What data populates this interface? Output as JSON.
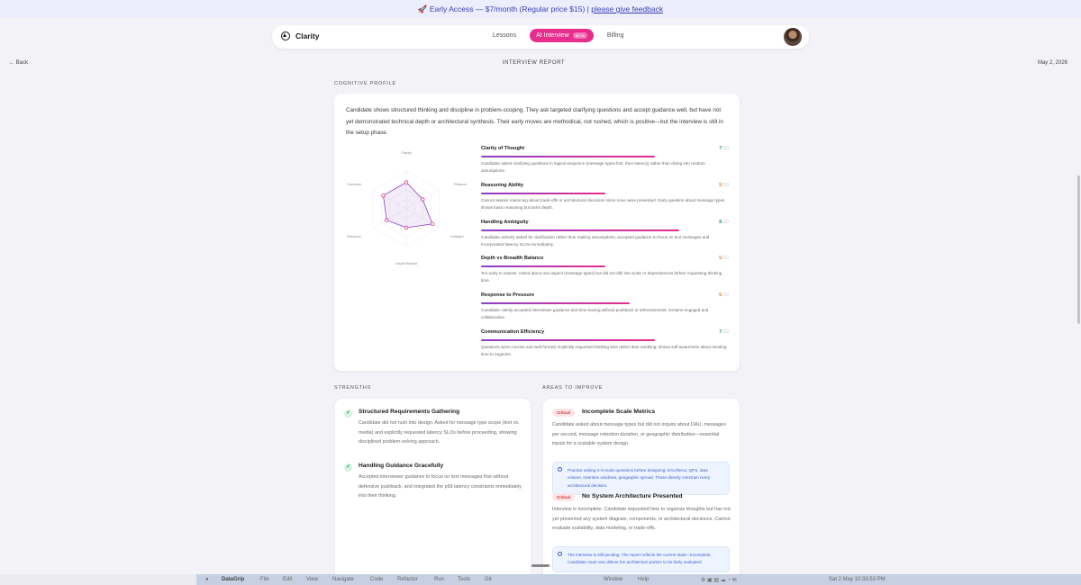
{
  "banner": {
    "text": "🚀 Early Access — $7/month (Regular price $15) |",
    "link": "please give feedback"
  },
  "navbar": {
    "brand": "Clarity",
    "tabs": [
      {
        "label": "Lessons"
      },
      {
        "label": "AI Interview",
        "badge": "BETA"
      },
      {
        "label": "Billing"
      }
    ],
    "active_tab": "AI Interview"
  },
  "header": {
    "back": "Back",
    "title": "INTERVIEW REPORT",
    "date": "May 2, 2026"
  },
  "cognitive_profile": {
    "label": "COGNITIVE PROFILE",
    "summary": "Candidate shows structured thinking and discipline in problem-scoping. They ask targeted clarifying questions and accept guidance well, but have not yet demonstrated technical depth or architectural synthesis. Their early moves are methodical, not rushed, which is positive—but the interview is still in the setup phase.",
    "radar_labels": [
      "Clarity",
      "Reason",
      "Ambigui",
      "Depth Breadt",
      "Pressure",
      "Commun"
    ],
    "metrics": [
      {
        "title": "Clarity of Thought",
        "score": "7",
        "max": "/10",
        "value": 7,
        "color": "#2aa58a",
        "desc": "Candidate asked clarifying questions in logical sequence (message types first, then latency) rather than diving into random assumptions."
      },
      {
        "title": "Reasoning Ability",
        "score": "5",
        "max": "/10",
        "value": 5,
        "color": "#e0912f",
        "desc": "Cannot assess reasoning about trade-offs or architectural decisions since none were presented. Early question about message types shows basic reasoning but lacks depth."
      },
      {
        "title": "Handling Ambiguity",
        "score": "8",
        "max": "/10",
        "value": 8,
        "color": "#2aa58a",
        "desc": "Candidate actively asked for clarification rather than making assumptions; accepted guidance to focus on text messages and incorporated latency SLOs immediately."
      },
      {
        "title": "Depth vs Breadth Balance",
        "score": "5",
        "max": "/10",
        "value": 5,
        "color": "#e0912f",
        "desc": "Too early to assess. Asked about one aspect (message types) but did not drill into scale or dependencies before requesting thinking time."
      },
      {
        "title": "Response to Pressure",
        "score": "6",
        "max": "/10",
        "value": 6,
        "color": "#e0912f",
        "desc": "Candidate calmly accepted interviewer guidance and time-boxing without pushback or defensiveness; remains engaged and collaborative."
      },
      {
        "title": "Communication Efficiency",
        "score": "7",
        "max": "/10",
        "value": 7,
        "color": "#2aa58a",
        "desc": "Questions were concise and well-formed. Explicitly requested thinking time rather than rambling; shows self-awareness about needing time to organize."
      }
    ]
  },
  "strengths": {
    "label": "STRENGTHS",
    "items": [
      {
        "title": "Structured Requirements Gathering",
        "desc": "Candidate did not rush into design. Asked for message type scope (text vs. media) and explicitly requested latency SLOs before proceeding, showing disciplined problem-solving approach."
      },
      {
        "title": "Handling Guidance Gracefully",
        "desc": "Accepted interviewer guidance to focus on text messages first without defensive pushback, and integrated the p99 latency constraints immediately into their thinking."
      }
    ]
  },
  "improve": {
    "label": "AREAS TO IMPROVE",
    "items": [
      {
        "badge": "Critical",
        "title": "Incomplete Scale Metrics",
        "desc": "Candidate asked about message types but did not inquire about DAU, messages per second, message retention duration, or geographic distribution—essential inputs for a scalable system design.",
        "tip": "Practice asking 3–5 scale questions before designing: DAU/MAU, QPS, data volume, retention windows, geographic spread. These directly constrain every architectural decision."
      },
      {
        "badge": "Critical",
        "title": "No System Architecture Presented",
        "desc": "Interview is incomplete. Candidate requested time to organize thoughts but has not yet presented any system diagram, components, or architectural decisions. Cannot evaluate scalability, data modeling, or trade-offs.",
        "tip": "The interview is still pending. The report reflects the current state—incomplete. Candidate must now deliver the architecture portion to be fairly evaluated."
      }
    ]
  },
  "menubar": {
    "app": "DataGrip",
    "menus": [
      "File",
      "Edit",
      "View",
      "Navigate",
      "Code",
      "Refactor",
      "Run",
      "Tools",
      "Git",
      "Window",
      "Help"
    ],
    "clock": "Sat 2 May  10:33:53 PM"
  }
}
